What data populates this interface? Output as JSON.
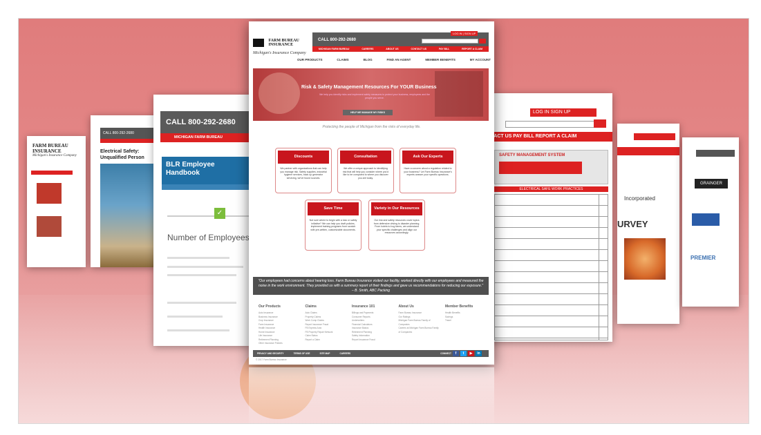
{
  "colors": {
    "stage": "#e07c7c",
    "brand_red": "#c8161d",
    "dark_gray": "#5a5a5a",
    "orange": "#e8832e"
  },
  "pages": {
    "far_left": {
      "logo": "FARM BUREAU INSURANCE",
      "tagline": "Michigan's Insurance Company"
    },
    "second": {
      "phone": "CALL 800-292-2680",
      "caption": "Electrical Safety: Unqualified Person"
    },
    "third": {
      "phone": "CALL 800-292-2680",
      "red_bar": "MICHIGAN FARM BUREAU",
      "blr_title": "BLR Employee Handbook",
      "heading": "Number of Employees"
    },
    "right": {
      "login": "LOG IN  SIGN UP",
      "go": "GO",
      "nav": "CONTACT US   PAY BILL   REPORT A CLAIM",
      "panel_title": "SAFETY MANAGEMENT SYSTEM",
      "section_title": "ELECTRICAL SAFE WORK PRACTICES"
    },
    "right2": {
      "text1": "Incorporated",
      "text2": "URVEY"
    },
    "far_right": {
      "logo1": "GRAINGER",
      "logo3": "PREMIER"
    }
  },
  "main": {
    "logo": {
      "name_line1": "FARM BUREAU",
      "name_line2": "INSURANCE",
      "tagline": "Michigan's Insurance Company"
    },
    "phone": "CALL 800-292-2680",
    "login": "LOG IN  |  SIGN UP",
    "red_nav": [
      "MICHIGAN FARM BUREAU",
      "CAREERS",
      "ABOUT US",
      "CONTACT US",
      "PAY BILL",
      "REPORT A CLAIM"
    ],
    "nav": [
      "OUR PRODUCTS",
      "CLAIMS",
      "BLOG",
      "FIND AN AGENT",
      "MEMBER BENEFITS",
      "MY ACCOUNT"
    ],
    "hero": {
      "title": "Risk & Safety Management Resources For YOUR Business",
      "subtitle": "We help you identify risks and implement safety measures to protect your business, employees and the people you serve.",
      "button": "HELP ME MANAGE MY RISKS"
    },
    "tagline": "Protecting the people of Michigan from the risks of everyday life.",
    "cards": [
      {
        "title": "Discounts",
        "body": "We partner with organizations that can help you manage risk. Safety supplies, industrial hygiene services, back up generator servicing, we've found sources."
      },
      {
        "title": "Consultation",
        "body": "We offer a unique approach to identifying risk that will help you consider where you'd like to be compared to where you discover you are today."
      },
      {
        "title": "Ask Our Experts",
        "body": "Have a concern about a regulation related to your business? Let Farm Bureau Insurance's experts answer your specific questions."
      },
      {
        "title": "Save Time",
        "body": "Not sure where to begin with a loss or safety initiative? We can help you draft policies, implement training programs from scratch with pre-written, customizable documents."
      },
      {
        "title": "Variety in Our Resources",
        "body": "Our risk and safety resources cover topics from defensive driving to disaster planning. From hotels to hog farms, we understand your specific challenges and align our resources accordingly."
      }
    ],
    "quote": "\"Our employees had concerns about hearing loss. Farm Bureau Insurance visited our facility, worked directly with our employees and measured the noise in the work environment. They provided us with a summary report of their findings and gave us recommendations for reducing our exposure.\" – B. Smith, ABC Packing",
    "footer": [
      {
        "heading": "Our Products",
        "links": [
          "Auto Insurance",
          "Business Insurance",
          "Crop Insurance",
          "Farm Insurance",
          "Health Insurance",
          "Home Insurance",
          "Life Insurance",
          "Retirement Planning",
          "Other Insurance Policies"
        ]
      },
      {
        "heading": "Claims",
        "links": [
          "Auto Claims",
          "Property Claims",
          "Work Comp Claims",
          "Report Insurance Fraud",
          "FB Express Auto",
          "FB Property Repair Network",
          "Claim Status",
          "Report a Claim"
        ]
      },
      {
        "heading": "Insurance 101",
        "links": [
          "Billings and Payments",
          "Consumer Reports",
          "Underwriters",
          "Financial Calculators",
          "Insurance Basics",
          "Retirement Planning",
          "Safety Information",
          "Report Insurance Fraud"
        ]
      },
      {
        "heading": "About Us",
        "links": [
          "Farm Bureau Insurance",
          "Our Ratings",
          "Michigan Farm Bureau Family of Companies",
          "Careers at Michigan Farm Bureau Family of Companies"
        ]
      },
      {
        "heading": "Member Benefits",
        "links": [
          "Health Benefits",
          "Savings",
          "Travel"
        ]
      }
    ],
    "bottom_links": [
      "PRIVACY AND SECURITY",
      "TERMS OF USE",
      "SITE MAP",
      "CAREERS"
    ],
    "connect": "CONNECT",
    "social": [
      "f",
      "t",
      "▶",
      "in"
    ],
    "copyright": "© 2017 Farm Bureau Insurance"
  }
}
